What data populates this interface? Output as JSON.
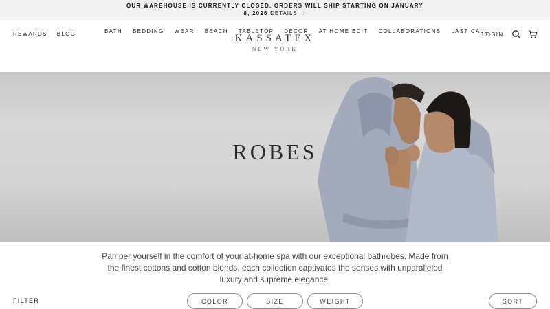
{
  "announcement": {
    "line1": "OUR WAREHOUSE IS CURRENTLY CLOSED. ORDERS WILL SHIP STARTING ON JANUARY",
    "line2": "8, 2026",
    "details": "DETAILS",
    "arrow": "→"
  },
  "header": {
    "left_links": [
      "REWARDS",
      "BLOG"
    ],
    "nav": [
      "BATH",
      "BEDDING",
      "WEAR",
      "BEACH",
      "TABLETOP",
      "DECOR",
      "AT HOME EDIT",
      "COLLABORATIONS",
      "LAST CALL"
    ],
    "logo": {
      "brand": "KASSATEX",
      "sub": "NEW YORK"
    },
    "login": "LOGIN",
    "icons": [
      "search-icon",
      "cart-icon"
    ]
  },
  "hero": {
    "title": "ROBES"
  },
  "description": "Pamper yourself in the comfort of your at-home spa with our exceptional bathrobes. Made from the finest cottons and cotton blends, each collection captivates the senses with unparalleled luxury and supreme elegance.",
  "filters": {
    "label": "FILTER",
    "options": [
      "COLOR",
      "SIZE",
      "WEIGHT"
    ],
    "sort": "SORT"
  },
  "colors": {
    "announcement_bg": "#f3f3f3",
    "robe": "#a3aabb",
    "text": "#222222"
  }
}
